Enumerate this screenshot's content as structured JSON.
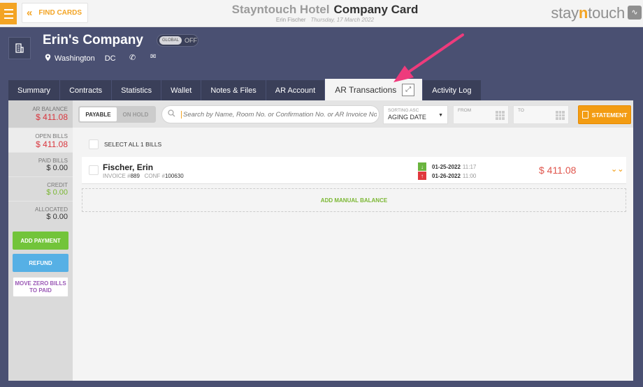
{
  "header": {
    "find_cards": "FIND CARDS",
    "hotel_name": "Stayntouch Hotel",
    "card_type": "Company Card",
    "user_name": "Erin Fischer",
    "date": "Thursday, 17 March 2022",
    "logo_prefix": "stay",
    "logo_highlight": "n",
    "logo_suffix": "touch",
    "logo_icon": "pulse-icon"
  },
  "company": {
    "name": "Erin's Company",
    "global_label": "GLOBAL",
    "global_state": "OFF",
    "city": "Washington",
    "state": "DC"
  },
  "tabs": [
    {
      "label": "Summary"
    },
    {
      "label": "Contracts"
    },
    {
      "label": "Statistics"
    },
    {
      "label": "Wallet"
    },
    {
      "label": "Notes & Files"
    },
    {
      "label": "AR Account"
    },
    {
      "label": "AR Transactions",
      "active": true
    },
    {
      "label": "Activity Log"
    }
  ],
  "sidebar": {
    "ar_balance_label": "AR BALANCE",
    "ar_balance": "$ 411.08",
    "open_bills_label": "OPEN BILLS",
    "open_bills": "$ 411.08",
    "paid_bills_label": "PAID BILLS",
    "paid_bills": "$ 0.00",
    "credit_label": "CREDIT",
    "credit": "$ 0.00",
    "allocated_label": "ALLOCATED",
    "allocated": "$ 0.00",
    "add_payment": "ADD PAYMENT",
    "refund": "REFUND",
    "move_zero": "MOVE ZERO BILLS TO PAID"
  },
  "toolbar": {
    "payable": "PAYABLE",
    "on_hold": "ON HOLD",
    "search_placeholder": "Search by Name, Room No. or Confirmation No. or AR Invoice No.",
    "sorting_label": "SORTING ASC",
    "sorting_value": "AGING DATE",
    "from_label": "FROM",
    "to_label": "TO",
    "statement": "STATEMENT"
  },
  "bills": {
    "select_all": "SELECT ALL 1 BILLS",
    "items": [
      {
        "name": "Fischer, Erin",
        "invoice_label": "INVOICE #",
        "invoice": "889",
        "conf_label": "CONF #",
        "conf": "100630",
        "date_in": "01-25-2022",
        "time_in": "11:17",
        "date_out": "01-26-2022",
        "time_out": "11:00",
        "amount": "$ 411.08"
      }
    ],
    "add_manual": "ADD MANUAL BALANCE"
  },
  "colors": {
    "accent": "#f3a424",
    "nav": "#4a5072",
    "negative": "#d9363e",
    "positive": "#7bb733",
    "pointer": "#ee3b7c"
  }
}
